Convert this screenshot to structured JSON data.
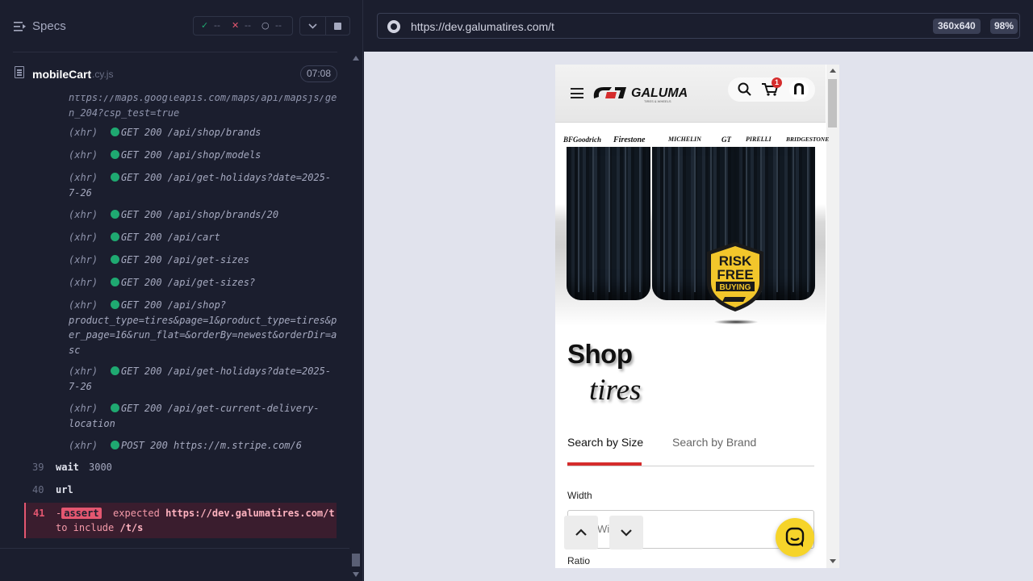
{
  "runner": {
    "specs_label": "Specs",
    "stats": {
      "pass_icon": "✓",
      "pass": "--",
      "fail_icon": "✕",
      "fail": "--",
      "pending_icon": "○",
      "pending": "--"
    },
    "spec_file": {
      "name": "mobileCart",
      "ext": ".cy.js",
      "duration": "07:08"
    },
    "log": [
      {
        "type": "",
        "text": "https://maps.googleapis.com/maps/api/mapsjs/ge n_204?csp_test=true"
      },
      {
        "type": "(xhr)",
        "text": "GET 200 /api/shop/brands"
      },
      {
        "type": "(xhr)",
        "text": "GET 200 /api/shop/models"
      },
      {
        "type": "(xhr)",
        "text": "GET 200 /api/get-holidays?date=2025-7-26"
      },
      {
        "type": "(xhr)",
        "text": "GET 200 /api/shop/brands/20"
      },
      {
        "type": "(xhr)",
        "text": "GET 200 /api/cart"
      },
      {
        "type": "(xhr)",
        "text": "GET 200 /api/get-sizes"
      },
      {
        "type": "(xhr)",
        "text": "GET 200 /api/get-sizes?"
      },
      {
        "type": "(xhr)",
        "text": "GET 200 /api/shop? product_type=tires&page=1&product_type=tires&p er_page=16&run_flat=&orderBy=newest&orderDir=a sc"
      },
      {
        "type": "(xhr)",
        "text": "GET 200 /api/get-holidays?date=2025-7-26"
      },
      {
        "type": "(xhr)",
        "text": "GET 200 /api/get-current-delivery-location"
      },
      {
        "type": "(xhr)",
        "text": "POST 200 https://m.stripe.com/6"
      }
    ],
    "steps": [
      {
        "num": "39",
        "cmd": "wait",
        "arg": "3000"
      },
      {
        "num": "40",
        "cmd": "url",
        "arg": ""
      }
    ],
    "assert": {
      "num": "41",
      "prefix": "-",
      "badge": "assert",
      "expected": "expected",
      "url": "https://dev.galumatires.com/t",
      "to_include": "to include",
      "value": "/t/s"
    }
  },
  "preview": {
    "url": "https://dev.galumatires.com/t",
    "viewport": "360x640",
    "zoom": "98%"
  },
  "site": {
    "logo_text": "GALUMA",
    "logo_tagline": "TIRES & WHEELS",
    "cart_count": "1",
    "brands": [
      "BFGoodrich",
      "Firestone",
      "MICHELIN",
      "GT",
      "PIRELLI",
      "BRIDGESTONE"
    ],
    "badge_lines": [
      "RISK",
      "FREE",
      "BUYING"
    ],
    "shop_title": "Shop",
    "shop_sub": "tires",
    "tabs": [
      "Search by Size",
      "Search by Brand"
    ],
    "width_label": "Width",
    "width_placeholder": "Width",
    "ratio_label": "Ratio"
  },
  "colors": {
    "accent_red": "#d52c2c",
    "pass_green": "#1fa971",
    "fail_red": "#e45770",
    "chat_yellow": "#f6d42a"
  }
}
